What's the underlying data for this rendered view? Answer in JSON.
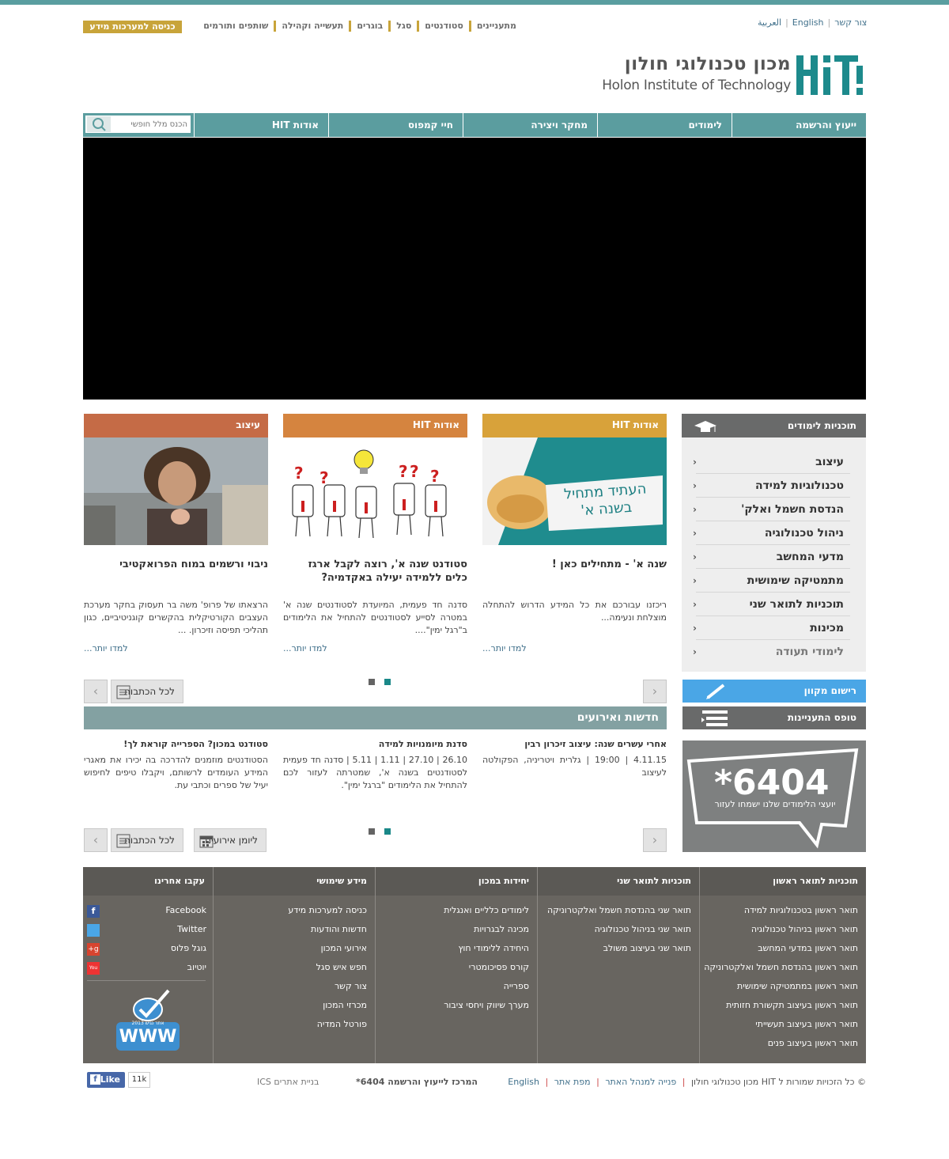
{
  "colors": {
    "teal": "#5b9d9f",
    "gold": "#c8a43a",
    "orange": "#c56b46",
    "mustard": "#d8a23a",
    "footer": "#686560",
    "footer_header": "#5b5955",
    "gray": "#696a6a",
    "blue": "#4aa6e6"
  },
  "top_links": [
    "צור קשר",
    "English",
    "العربية"
  ],
  "quick_links": [
    "מתעניינים",
    "סטודנטים",
    "סגל",
    "בוגרים",
    "תעשייה וקהילה",
    "שותפים ותורמים"
  ],
  "info_systems_button": "כניסה למערכות מידע",
  "logo": {
    "mark": "HIT",
    "hebrew": "מכון טכנולוגי חולון",
    "english": "Holon Institute of Technology"
  },
  "nav": [
    "ייעוץ והרשמה",
    "לימודים",
    "מחקר ויצירה",
    "חיי קמפוס",
    "אודות HIT"
  ],
  "search": {
    "placeholder": "הכנס מלל חופשי"
  },
  "cards": [
    {
      "category": "אודות HIT",
      "image_text": "העתיד מתחיל בשנה א'",
      "title": "שנה א' - מתחילים כאן !",
      "text": "ריכזנו עבורכם את כל המידע הדרוש להתחלה מוצלחת ונעימה...",
      "more": "למדו יותר..."
    },
    {
      "category": "אודות HIT",
      "title": "סטודנט שנה א', רוצה לקבל ארגז כלים ללמידה יעילה באקדמיה?",
      "text": "סדנה חד פעמית, המיועדת לסטודנטים שנה א' במטרה לסייע לסטודנטים להתחיל את הלימודים ב\"רגל ימין\"....",
      "more": "למדו יותר..."
    },
    {
      "category": "עיצוב",
      "title": "ניבוי ורשמים במוח הפרואקטיבי",
      "text": "הרצאתו של פרופ' משה בר תעסוק בחקר מערכת העצבים הקורטיקלית בהקשרים קוגניטיביים, כגון תהליכי תפיסה וזיכרון. ...",
      "more": "למדו יותר..."
    }
  ],
  "studies": {
    "title": "תוכניות לימודים",
    "items": [
      "עיצוב",
      "טכנולוגיות למידה",
      "הנדסת חשמל ואלק'",
      "ניהול טכנולוגיה",
      "מדעי המחשב",
      "מתמטיקה שימושית",
      "תוכניות לתואר שני",
      "מכינות",
      "לימודי תעודה"
    ]
  },
  "online_registration": "רישום מקוון",
  "interest_form": "טופס התעניינות",
  "phone": {
    "number": "6404",
    "star": "*",
    "caption": "יועצי הלימודים שלנו ישמחו לעזור"
  },
  "all_articles": "לכל הכתבות",
  "events_calendar": "ליומן אירועים",
  "news": {
    "title": "חדשות ואירועים",
    "items": [
      {
        "title": "אחרי עשרים שנה: עיצוב זיכרון רבין",
        "body": "4.11.15 | 19:00 | גלרית ויטריניה, הפקולטה לעיצוב"
      },
      {
        "title": "סדנת מיומנויות למידה",
        "body": "26.10 | 27.10 | 1.11 | 5.11 | סדנה חד פעמית לסטודנטים בשנה א', שמטרתה לעזור לכם להתחיל את הלימודים \"ברגל ימין\"."
      },
      {
        "title": "סטודנט במכון? הספרייה קוראת לך!",
        "body": "הסטודנטים מוזמנים להדרכה בה יכירו את מאגרי המידע העומדים לרשותם, ויקבלו טיפים לחיפוש יעיל של ספרים וכתבי עת."
      }
    ]
  },
  "footer": {
    "columns": [
      {
        "title": "תוכניות לתואר ראשון",
        "items": [
          "תואר ראשון בטכנולוגיות למידה",
          "תואר ראשון בניהול טכנולוגיה",
          "תואר ראשון במדעי המחשב",
          "תואר ראשון בהנדסת חשמל ואלקטרוניקה",
          "תואר ראשון במתמטיקה שימושית",
          "תואר ראשון בעיצוב תקשורת חזותית",
          "תואר ראשון בעיצוב תעשייתי",
          "תואר ראשון בעיצוב פנים"
        ]
      },
      {
        "title": "תוכניות לתואר שני",
        "items": [
          "תואר שני בהנדסת חשמל ואלקטרוניקה",
          "תואר שני בניהול טכנולוגיה",
          "תואר שני בעיצוב משולב"
        ]
      },
      {
        "title": "יחידות במכון",
        "items": [
          "לימודים כלליים ואנגלית",
          "מכינה לבגרויות",
          "היחידה ללימודי חוץ",
          "קורס פסיכומטרי",
          "ספרייה",
          "מערך שיווק ויחסי ציבור"
        ]
      },
      {
        "title": "מידע שימושי",
        "items": [
          "כניסה למערכות מידע",
          "חדשות והודעות",
          "אירועי המכון",
          "חפש איש סגל",
          "צור קשר",
          "מכרזי המכון",
          "פורטל המדיה"
        ]
      },
      {
        "title": "עקבו אחרינו",
        "items": [
          "Facebook",
          "Twitter",
          "גוגל פלוס",
          "יוטיוב"
        ]
      }
    ],
    "badge": {
      "text": "אתר נגיש 2013",
      "www": "WWW"
    }
  },
  "bottom": {
    "copyright": "© כל הזכויות שמורות ל HIT מכון טכנולוגי חולון",
    "links": [
      "פנייה למנהל האתר",
      "מפת אתר",
      "English"
    ],
    "center": "המרכז לייעוץ והרשמה 6404*",
    "credit": "בניית אתרים ICS",
    "like": "Like",
    "like_count": "11k"
  }
}
